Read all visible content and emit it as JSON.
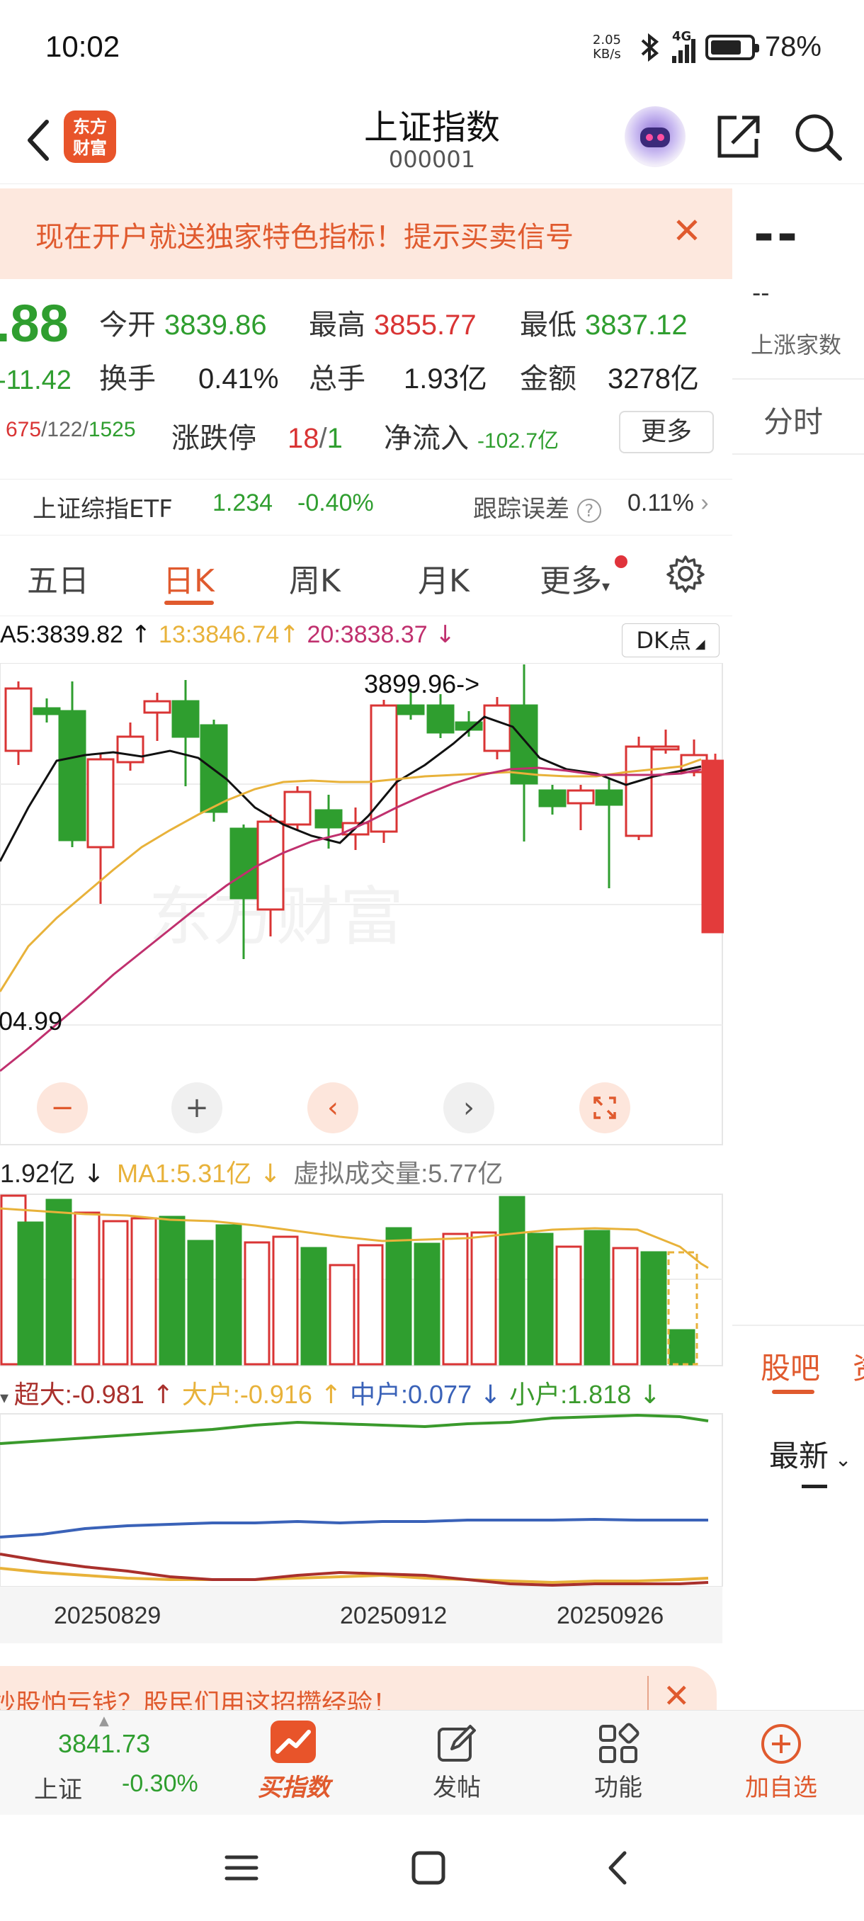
{
  "status_bar": {
    "time": "10:02",
    "net_speed_value": "2.05",
    "net_speed_unit": "KB/s",
    "network": "4G",
    "battery": "78%",
    "battery_level": 0.78
  },
  "header": {
    "logo_line1": "东方",
    "logo_line2": "财富",
    "title": "上证指数",
    "code": "000001"
  },
  "promo": {
    "text": "现在开户就送独家特色指标！提示买卖信号",
    "close": "✕"
  },
  "quote": {
    "last_price": ".88",
    "change": "-11.42",
    "open_label": "今开",
    "open": "3839.86",
    "high_label": "最高",
    "high": "3855.77",
    "low_label": "最低",
    "low": "3837.12",
    "turnover_label": "换手",
    "turnover": "0.41%",
    "volume_label": "总手",
    "volume": "1.93亿",
    "amount_label": "金额",
    "amount": "3278亿",
    "up_count": "675",
    "flat_count": "122",
    "down_count": "1525",
    "limit_label": "涨跌停",
    "limit_up": "18",
    "limit_down": "1",
    "netflow_label": "净流入",
    "netflow": "-102.7亿",
    "more": "更多"
  },
  "etf": {
    "name": "上证综指ETF",
    "price": "1.234",
    "change": "-0.40%",
    "tracking_label": "跟踪误差",
    "tracking_value": "0.11%"
  },
  "period_tabs": [
    "五日",
    "日K",
    "周K",
    "月K",
    "更多"
  ],
  "active_tab": "日K",
  "ma_legend": {
    "ma5": "A5:3839.82",
    "ma13": "13:3846.74",
    "ma20": "20:3838.37",
    "dk_button": "DK点"
  },
  "kline": {
    "high_annotation": "3899.96->",
    "low_annotation": "04.99",
    "watermark": "东方财富"
  },
  "volume_legend": {
    "vol": "1.92亿",
    "ma1": "MA1:5.31亿",
    "virtual": "虚拟成交量:5.77亿"
  },
  "flow_legend": {
    "super": "超大:-0.981",
    "large": "大户:-0.916",
    "medium": "中户:0.077",
    "small": "小户:1.818"
  },
  "x_axis": [
    "20250829",
    "20250912",
    "20250926"
  ],
  "bottom_promo": {
    "text": "炒股怕亏钱？股民们用这招攒经验！",
    "close": "✕"
  },
  "right_panel": {
    "value": "--",
    "sub_value": "--",
    "label": "上涨家数",
    "tab_fenshi": "分时",
    "tab_guba": "股吧",
    "tab_next": "资",
    "sort": "最新"
  },
  "bottom_nav": {
    "index_value": "3841.73",
    "index_name": "上证",
    "index_change": "-0.30%",
    "buy_index": "买指数",
    "post": "发帖",
    "functions": "功能",
    "add_watch": "加自选"
  },
  "colors": {
    "accent": "#e05a2e",
    "up": "#d93434",
    "down": "#2f9e2f",
    "ma5": "#111111",
    "ma13": "#e8b23a",
    "ma20": "#c0306e"
  }
}
